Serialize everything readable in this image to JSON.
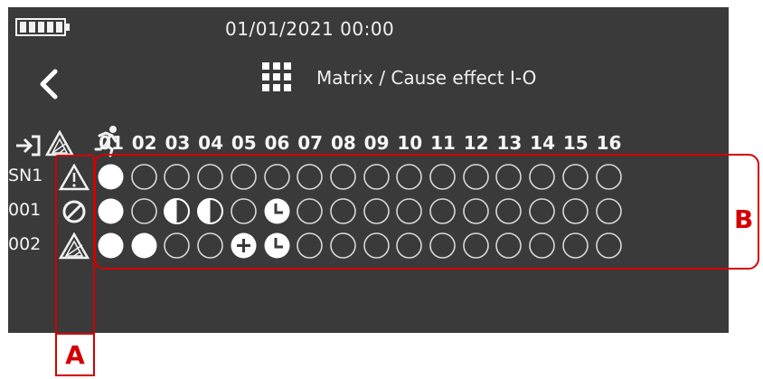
{
  "header": {
    "datetime": "01/01/2021  00:00",
    "title": "Matrix / Cause effect I-O"
  },
  "icons": {
    "battery": "battery-full-icon",
    "back": "chevron-left-icon",
    "menu": "grid-icon",
    "input": "input-arrow-icon",
    "zone": "zone-warning-icon",
    "exit": "emergency-exit-icon"
  },
  "columns": [
    "01",
    "02",
    "03",
    "04",
    "05",
    "06",
    "07",
    "08",
    "09",
    "10",
    "11",
    "12",
    "13",
    "14",
    "15",
    "16"
  ],
  "rows": [
    {
      "label": "SN1",
      "icon": "warning-triangle-icon",
      "cells": [
        "full",
        "empty",
        "empty",
        "empty",
        "empty",
        "empty",
        "empty",
        "empty",
        "empty",
        "empty",
        "empty",
        "empty",
        "empty",
        "empty",
        "empty",
        "empty"
      ]
    },
    {
      "label": "001",
      "icon": "disabled-circle-icon",
      "cells": [
        "full",
        "empty",
        "half",
        "half",
        "empty",
        "clock",
        "empty",
        "empty",
        "empty",
        "empty",
        "empty",
        "empty",
        "empty",
        "empty",
        "empty",
        "empty"
      ]
    },
    {
      "label": "002",
      "icon": "zone-warning-icon",
      "cells": [
        "full",
        "full",
        "empty",
        "empty",
        "plus",
        "clock",
        "empty",
        "empty",
        "empty",
        "empty",
        "empty",
        "empty",
        "empty",
        "empty",
        "empty",
        "empty"
      ]
    }
  ],
  "callouts": {
    "a_label": "A",
    "b_label": "B"
  },
  "colors": {
    "screen_bg": "#3a3a3a",
    "foreground": "#f2f2f2",
    "callout": "#d40000"
  }
}
